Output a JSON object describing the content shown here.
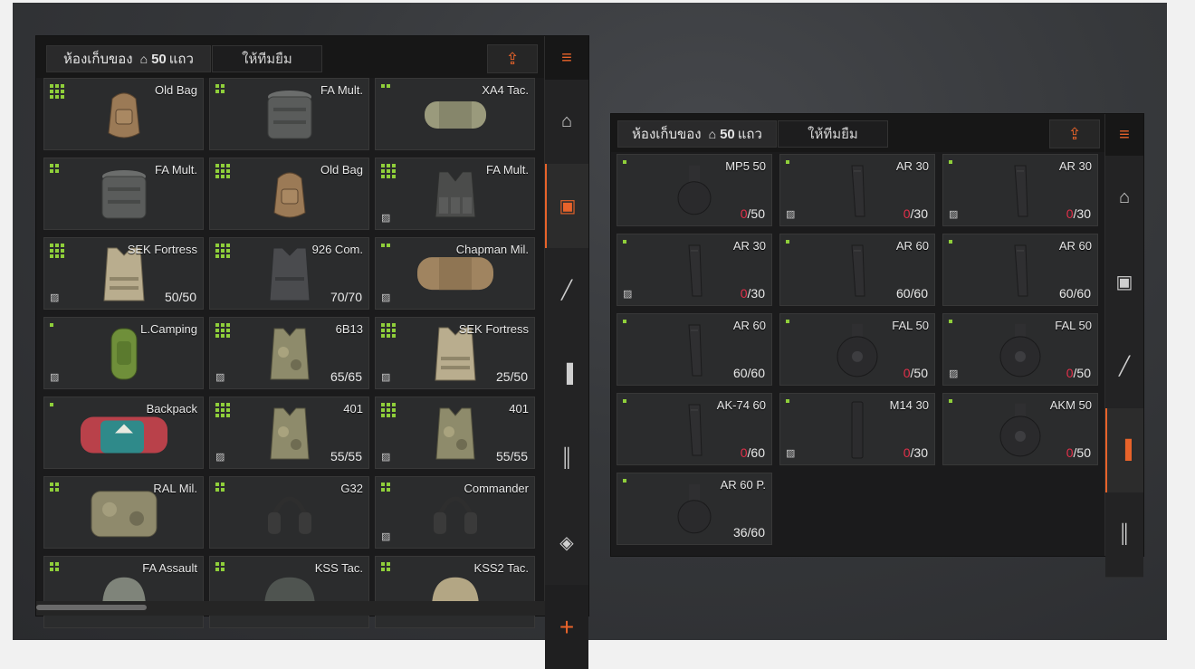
{
  "colors": {
    "accent": "#e8632a",
    "size_green": "#8fcf3a",
    "empty_red": "#e2304a"
  },
  "left_panel": {
    "storage_tab": {
      "label": "ห้องเก็บของ",
      "home_icon": "home-icon",
      "count": "50",
      "unit": "แถว"
    },
    "lend_tab": "ให้ทีมยืม",
    "cart_icon": "cart-icon",
    "sidebar": [
      "stack-icon",
      "home-icon",
      "vest-icon",
      "rifle-icon",
      "magazine-icon",
      "ammo-icon",
      "sight-icon",
      "plus-icon"
    ],
    "active_index": 2,
    "items": [
      {
        "name": "Old Bag",
        "size": 9,
        "art": "backpack"
      },
      {
        "name": "FA Mult.",
        "size": 4,
        "art": "pouch"
      },
      {
        "name": "XA4 Tac.",
        "size": 2,
        "art": "duffel"
      },
      {
        "name": "FA Mult.",
        "size": 4,
        "art": "pouch"
      },
      {
        "name": "Old Bag",
        "size": 9,
        "art": "backpack"
      },
      {
        "name": "FA Mult.",
        "size": 9,
        "art": "rig",
        "bound": true
      },
      {
        "name": "SEK Fortress",
        "size": 9,
        "art": "vest",
        "bound": true,
        "qty": "50/50"
      },
      {
        "name": "926 Com.",
        "size": 9,
        "art": "vest-dark",
        "qty": "70/70"
      },
      {
        "name": "Chapman Mil.",
        "size": 2,
        "art": "duffel-tan",
        "bound": true
      },
      {
        "name": "L.Camping",
        "size": 1,
        "art": "bag-green",
        "bound": true
      },
      {
        "name": "6B13",
        "size": 9,
        "art": "vest-camo",
        "bound": true,
        "qty": "65/65"
      },
      {
        "name": "SEK Fortress",
        "size": 9,
        "art": "vest",
        "bound": true,
        "qty": "25/50"
      },
      {
        "name": "Backpack",
        "size": 1,
        "art": "backpack-red"
      },
      {
        "name": "401",
        "size": 9,
        "art": "vest-camo",
        "bound": true,
        "qty": "55/55"
      },
      {
        "name": "401",
        "size": 9,
        "art": "vest-camo",
        "bound": true,
        "qty": "55/55"
      },
      {
        "name": "RAL Mil.",
        "size": 4,
        "art": "vest-wide"
      },
      {
        "name": "G32",
        "size": 4,
        "art": "headset"
      },
      {
        "name": "Commander",
        "size": 4,
        "art": "headset",
        "bound": true
      },
      {
        "name": "FA Assault",
        "size": 4,
        "art": "helmet"
      },
      {
        "name": "KSS Tac.",
        "size": 4,
        "art": "helmet-dark"
      },
      {
        "name": "KSS2 Tac.",
        "size": 4,
        "art": "helmet-tan"
      }
    ]
  },
  "right_panel": {
    "storage_tab": {
      "label": "ห้องเก็บของ",
      "home_icon": "home-icon",
      "count": "50",
      "unit": "แถว"
    },
    "lend_tab": "ให้ทีมยืม",
    "cart_icon": "cart-icon",
    "sidebar": [
      "stack-icon",
      "home-icon",
      "vest-icon",
      "rifle-icon",
      "magazine-icon",
      "ammo-icon"
    ],
    "active_index": 4,
    "items": [
      {
        "name": "MP5 50",
        "art": "drum",
        "qty_cur": "0",
        "qty_max": "50"
      },
      {
        "name": "AR 30",
        "art": "mag",
        "bound": true,
        "qty_cur": "0",
        "qty_max": "30"
      },
      {
        "name": "AR 30",
        "art": "mag",
        "bound": true,
        "qty_cur": "0",
        "qty_max": "30"
      },
      {
        "name": "AR 30",
        "art": "mag",
        "bound": true,
        "qty_cur": "0",
        "qty_max": "30"
      },
      {
        "name": "AR 60",
        "art": "mag",
        "qty_cur": "60",
        "qty_max": "60"
      },
      {
        "name": "AR 60",
        "art": "mag",
        "qty_cur": "60",
        "qty_max": "60"
      },
      {
        "name": "AR 60",
        "art": "mag",
        "qty_cur": "60",
        "qty_max": "60"
      },
      {
        "name": "FAL 50",
        "art": "drum-big",
        "qty_cur": "0",
        "qty_max": "50"
      },
      {
        "name": "FAL 50",
        "art": "drum-big",
        "bound": true,
        "qty_cur": "0",
        "qty_max": "50"
      },
      {
        "name": "AK-74 60",
        "art": "mag",
        "qty_cur": "0",
        "qty_max": "60"
      },
      {
        "name": "M14 30",
        "art": "mag-straight",
        "bound": true,
        "qty_cur": "0",
        "qty_max": "30"
      },
      {
        "name": "AKM 50",
        "art": "drum-big",
        "qty_cur": "0",
        "qty_max": "50"
      },
      {
        "name": "AR 60 P.",
        "art": "drum",
        "qty_cur": "36",
        "qty_max": "60"
      }
    ]
  }
}
